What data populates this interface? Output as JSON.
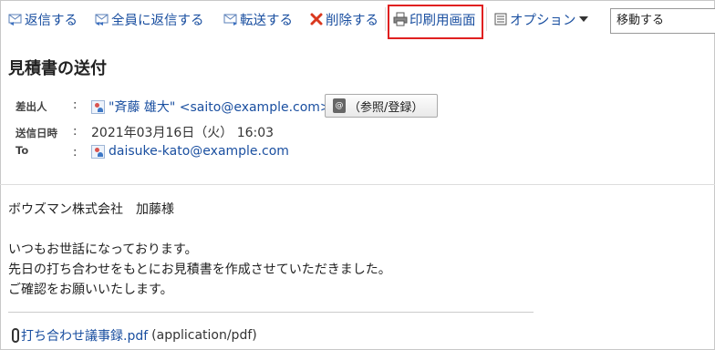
{
  "toolbar": {
    "reply": "返信する",
    "reply_all": "全員に返信する",
    "forward": "転送する",
    "delete": "削除する",
    "print": "印刷用画面",
    "options": "オプション",
    "move_select": "移動する"
  },
  "message": {
    "subject": "見積書の送付",
    "from_label": "差出人",
    "from_value": "\"斉藤 雄大\" <saito@example.com>",
    "ref_button": "（参照/登録）",
    "sent_label": "送信日時",
    "sent_value": "2021年03月16日（火） 16:03",
    "to_label": "To",
    "to_value": "daisuke-kato@example.com",
    "colon": ":",
    "body": [
      "ボウズマン株式会社　加藤様",
      "いつもお世話になっております。",
      "先日の打ち合わせをもとにお見積書を作成させていただきました。",
      "ご確認をお願いいたします。"
    ],
    "attachment_name": "打ち合わせ議事録.pdf",
    "attachment_type": "(application/pdf)"
  },
  "colors": {
    "link": "#1a4fa0",
    "highlight": "#e02020",
    "delete_icon": "#d9381e"
  },
  "icons": {
    "reply": "reply-icon",
    "reply_all": "reply-all-icon",
    "forward": "forward-icon",
    "delete": "delete-icon",
    "print": "printer-icon",
    "options": "list-icon"
  }
}
